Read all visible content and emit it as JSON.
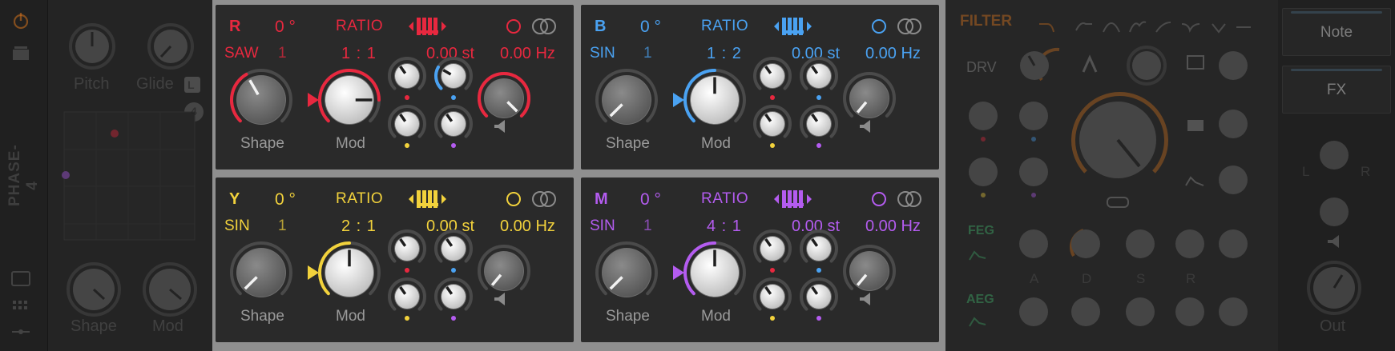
{
  "device": {
    "name": "PHASE-4"
  },
  "left_panel": {
    "pitch_label": "Pitch",
    "glide_label": "Glide",
    "glide_badge": "L",
    "voices_badge": "4",
    "shape_label": "Shape",
    "mod_label": "Mod"
  },
  "operators": [
    {
      "id": "R",
      "color": "#e8283f",
      "phase": "0 °",
      "ratio_title": "RATIO",
      "wave": "SAW",
      "wave_num": "1",
      "ratio": "1 : 1",
      "semitones": "0.00 st",
      "hz": "0.00 Hz",
      "shape_label": "Shape",
      "mod_label": "Mod",
      "keytrack_icon": "keyboard-icon",
      "link_icon": "link-icon",
      "ring_icon": "ring-icon"
    },
    {
      "id": "B",
      "color": "#4aa2f2",
      "phase": "0 °",
      "ratio_title": "RATIO",
      "wave": "SIN",
      "wave_num": "1",
      "ratio": "1 : 2",
      "semitones": "0.00 st",
      "hz": "0.00 Hz",
      "shape_label": "Shape",
      "mod_label": "Mod",
      "keytrack_icon": "keyboard-icon",
      "link_icon": "link-icon",
      "ring_icon": "ring-icon"
    },
    {
      "id": "Y",
      "color": "#f2d23c",
      "phase": "0 °",
      "ratio_title": "RATIO",
      "wave": "SIN",
      "wave_num": "1",
      "ratio": "2 : 1",
      "semitones": "0.00 st",
      "hz": "0.00 Hz",
      "shape_label": "Shape",
      "mod_label": "Mod",
      "keytrack_icon": "keyboard-icon",
      "link_icon": "link-icon",
      "ring_icon": "ring-icon"
    },
    {
      "id": "M",
      "color": "#b45cf0",
      "phase": "0 °",
      "ratio_title": "RATIO",
      "wave": "SIN",
      "wave_num": "1",
      "ratio": "4 : 1",
      "semitones": "0.00 st",
      "hz": "0.00 Hz",
      "shape_label": "Shape",
      "mod_label": "Mod",
      "keytrack_icon": "keyboard-icon",
      "link_icon": "link-icon",
      "ring_icon": "ring-icon"
    }
  ],
  "filter": {
    "title": "FILTER",
    "drv_label": "DRV",
    "feg_label": "FEG",
    "aeg_label": "AEG",
    "adsr": [
      "A",
      "D",
      "S",
      "R"
    ],
    "accent": "#d4731e"
  },
  "side": {
    "note_button": "Note",
    "fx_button": "FX",
    "left_label": "L",
    "right_label": "R",
    "out_label": "Out"
  }
}
